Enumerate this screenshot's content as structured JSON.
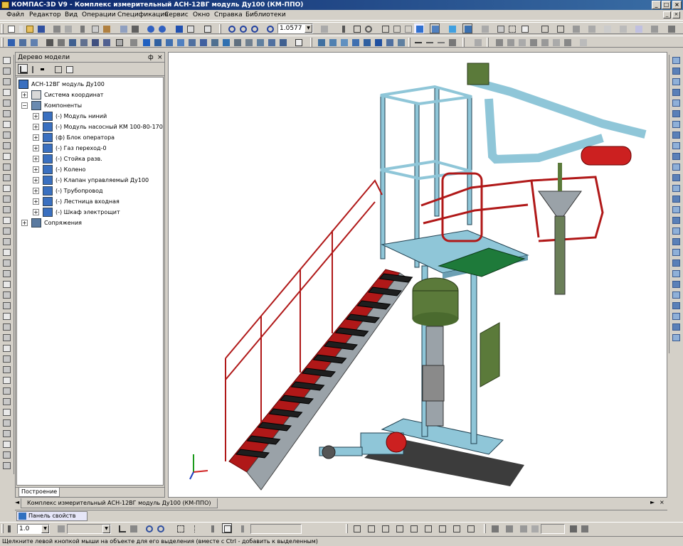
{
  "app": {
    "title": "КОМПАС-3D V9 - Комплекс измерительный АСН-12ВГ модуль Ду100 (КМ-ППО)",
    "window_buttons": [
      "_",
      "□",
      "×"
    ]
  },
  "menu": [
    "Файл",
    "Редактор",
    "Вид",
    "Операции",
    "Спецификация",
    "Сервис",
    "Окно",
    "Справка",
    "Библиотеки"
  ],
  "toolbar": {
    "zoom_value": "1.0577",
    "step_value": "1.0"
  },
  "tree": {
    "header": "Дерево модели",
    "header_pin": "ф",
    "header_close": "×",
    "root": "АСН-12ВГ модуль Ду100",
    "items": [
      {
        "label": "Система координат",
        "expander": "+"
      },
      {
        "label": "Компоненты",
        "expander": "−"
      },
      {
        "label": "(-) Модуль ниний",
        "expander": "+"
      },
      {
        "label": "(-) Модуль насосный КМ 100-80-170Е",
        "expander": "+"
      },
      {
        "label": "(ф) Блок оператора",
        "expander": "+"
      },
      {
        "label": "(-) Газ переход-0",
        "expander": "+"
      },
      {
        "label": "(-) Стойка разв.",
        "expander": "+"
      },
      {
        "label": "(-) Колено",
        "expander": "+"
      },
      {
        "label": "(-) Клапан управляемый Ду100",
        "expander": "+"
      },
      {
        "label": "(-) Трубопровод",
        "expander": "+"
      },
      {
        "label": "(-) Лестница входная",
        "expander": "+"
      },
      {
        "label": "(-) Шкаф электрощит",
        "expander": "+"
      },
      {
        "label": "Сопряжения",
        "expander": "+"
      }
    ],
    "tab": "Построение"
  },
  "document_tab": "Комплекс измерительный АСН-12ВГ модуль Ду100 (КМ-ППО)",
  "properties_tab": "Панель свойств",
  "status": "Щелкните левой кнопкой мыши на объекте для его выделения (вместе с Ctrl - добавить к выделенным)",
  "colors": {
    "titlebar": "#0a246a",
    "frame": "#8fc6d8",
    "rail": "#b01818",
    "tank": "#5b7a3a",
    "steel": "#9aa2a8"
  }
}
